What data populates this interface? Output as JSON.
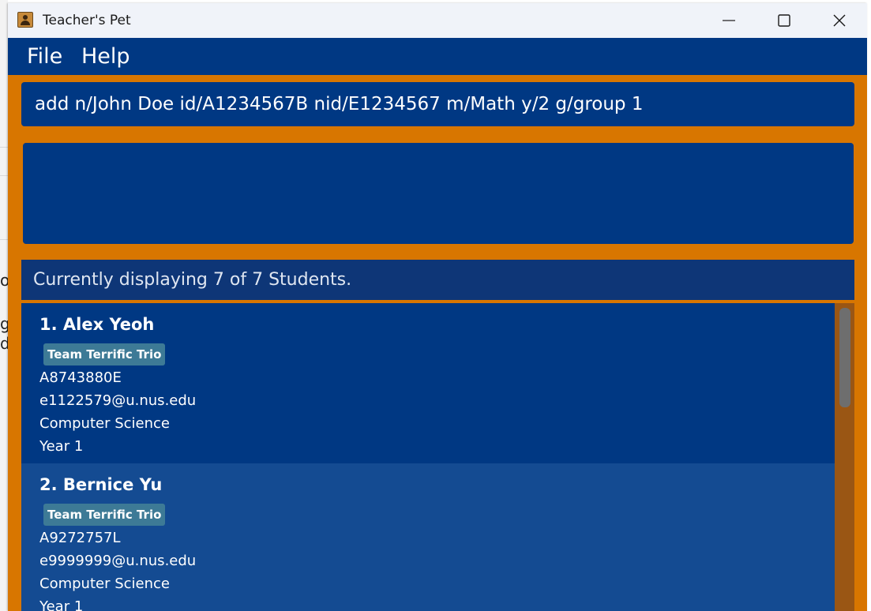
{
  "window": {
    "title": "Teacher's Pet"
  },
  "menu": {
    "items": [
      {
        "label": "File"
      },
      {
        "label": "Help"
      }
    ]
  },
  "command": {
    "value": "add n/John Doe id/A1234567B nid/E1234567 m/Math y/2 g/group 1"
  },
  "result": {
    "text": ""
  },
  "student_list": {
    "header": "Currently displaying 7 of 7 Students.",
    "students": [
      {
        "name": "1. Alex Yeoh",
        "group": "Team Terrific Trio",
        "id": "A8743880E",
        "email": "e1122579@u.nus.edu",
        "major": "Computer Science",
        "year": "Year 1"
      },
      {
        "name": "2. Bernice Yu",
        "group": "Team Terrific Trio",
        "id": "A9272757L",
        "email": "e9999999@u.nus.edu",
        "major": "Computer Science",
        "year": "Year 1"
      }
    ]
  },
  "background_window": {
    "glyphs": [
      "o",
      "g",
      "d"
    ]
  },
  "colors": {
    "frame_orange": "#d87600",
    "panel_blue": "#003883",
    "header_blue": "#0e3677",
    "card_selected": "#003883",
    "card_alt": "#144b92",
    "tag_teal": "#3d7a96",
    "titlebar": "#f0f3f9"
  },
  "icons": {
    "app": "teacher-contact-icon",
    "minimize": "minimize-icon",
    "maximize": "maximize-icon",
    "close": "close-icon"
  }
}
